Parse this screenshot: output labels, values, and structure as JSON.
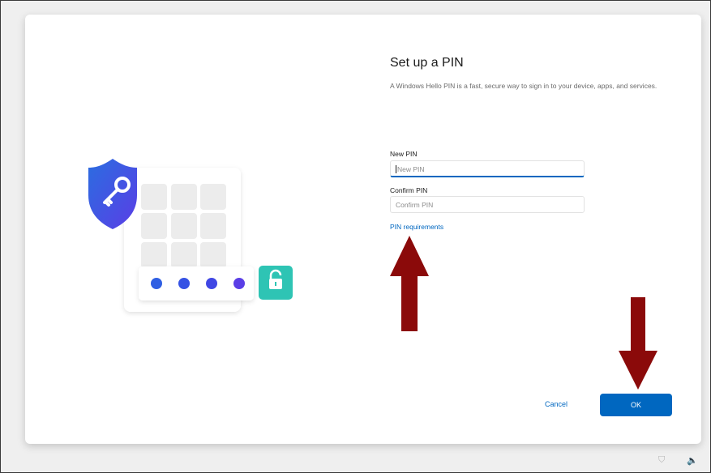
{
  "dialog": {
    "title": "Set up a PIN",
    "description": "A Windows Hello PIN is a fast, secure way to sign in to your device, apps, and services."
  },
  "new_pin": {
    "label": "New PIN",
    "placeholder": "New PIN",
    "value": ""
  },
  "confirm_pin": {
    "label": "Confirm PIN",
    "placeholder": "Confirm PIN",
    "value": ""
  },
  "links": {
    "pin_requirements": "PIN requirements"
  },
  "buttons": {
    "cancel": "Cancel",
    "ok": "OK"
  },
  "footer": {
    "accessibility_icon": "accessibility-icon",
    "volume_icon": "volume-icon",
    "accessibility_glyph": "⛉",
    "volume_glyph": "🔈"
  },
  "illustration": {
    "shield_icon": "shield-key-icon",
    "lock_icon": "unlock-icon",
    "pin_dot_count": 4
  },
  "colors": {
    "accent": "#0067c0",
    "annotation_arrow": "#8b0a0a",
    "shield": "#3d59e8",
    "lock_badge": "#2ec4b4",
    "pin_dots": "#3b4fe0"
  }
}
